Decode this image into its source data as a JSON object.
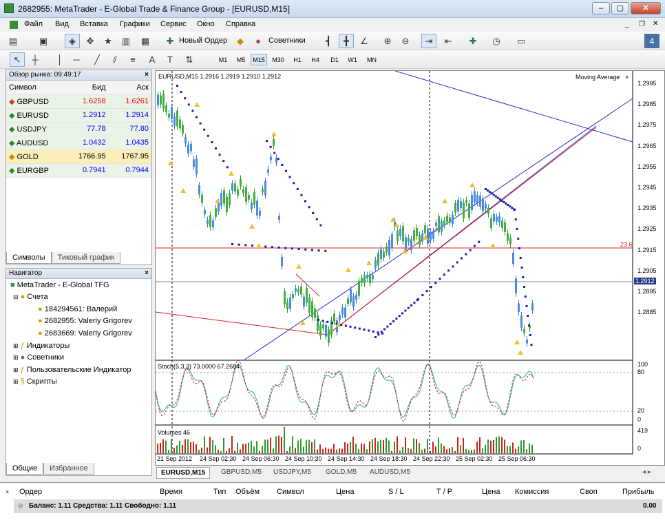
{
  "window": {
    "title": "2682955: MetaTrader - E-Global Trade & Finance Group - [EURUSD,M15]"
  },
  "menu": [
    "Файл",
    "Вид",
    "Вставка",
    "Графики",
    "Сервис",
    "Окно",
    "Справка"
  ],
  "toolbar": {
    "new_order": "Новый Ордер",
    "advisors": "Советники"
  },
  "timeframes": [
    "M1",
    "M5",
    "M15",
    "M30",
    "H1",
    "H4",
    "D1",
    "W1",
    "MN"
  ],
  "market_watch": {
    "title": "Обзор рынка: 09:49:17",
    "headers": {
      "symbol": "Символ",
      "bid": "Бид",
      "ask": "Аск"
    },
    "rows": [
      {
        "symbol": "GBPUSD",
        "bid": "1.6258",
        "ask": "1.6261"
      },
      {
        "symbol": "EURUSD",
        "bid": "1.2912",
        "ask": "1.2914"
      },
      {
        "symbol": "USDJPY",
        "bid": "77.78",
        "ask": "77.80"
      },
      {
        "symbol": "AUDUSD",
        "bid": "1.0432",
        "ask": "1.0435"
      },
      {
        "symbol": "GOLD",
        "bid": "1766.95",
        "ask": "1767.95"
      },
      {
        "symbol": "EURGBP",
        "bid": "0.7941",
        "ask": "0.7944"
      }
    ],
    "tabs": [
      "Символы",
      "Тиковый график"
    ]
  },
  "navigator": {
    "title": "Навигатор",
    "root": "MetaTrader - E-Global TFG",
    "accounts": "Счета",
    "account_list": [
      "184294561: Валерий",
      "2682955: Valeriy Grigorev",
      "2683669: Valeriy Grigorev"
    ],
    "sections": [
      "Индикаторы",
      "Советники",
      "Пользовательские Индикатор",
      "Скрипты"
    ],
    "tabs": [
      "Общие",
      "Избранное"
    ]
  },
  "chart": {
    "header": "EURUSD,M15  1.2916 1.2919 1.2910 1.2912",
    "indicator": "Moving Average",
    "price_ticks": [
      "1.2995",
      "1.2985",
      "1.2975",
      "1.2965",
      "1.2955",
      "1.2945",
      "1.2935",
      "1.2925",
      "1.2915",
      "1.2905",
      "1.2895",
      "1.2885"
    ],
    "current_price": "1.2912",
    "level_label": "23.6",
    "stoch_label": "Stoch(5,3,3) 73.0000 67.2684",
    "stoch_ticks": [
      "100",
      "80",
      "20",
      "0"
    ],
    "volumes_label": "Volumes 46",
    "volume_ticks": [
      "419",
      "0"
    ],
    "time_ticks": [
      "21 Sep 2012",
      "24 Sep 02:30",
      "24 Sep 06:30",
      "24 Sep 10:30",
      "24 Sep 14:30",
      "24 Sep 18:30",
      "24 Sep 22:30",
      "25 Sep 02:30",
      "25 Sep 06:30"
    ],
    "tabs": [
      "EURUSD,M15",
      "GBPUSD,M5",
      "USDJPY,M5",
      "GOLD,M5",
      "AUDUSD,M5"
    ]
  },
  "terminal": {
    "headers": [
      "Ордер",
      "Время",
      "Тип",
      "Объём",
      "Символ",
      "Цена",
      "S / L",
      "T / P",
      "Цена",
      "Комиссия",
      "Своп",
      "Прибыль"
    ],
    "balance": "Баланс: 1.11  Средства: 1.11  Свободно: 1.11",
    "profit": "0.00"
  }
}
